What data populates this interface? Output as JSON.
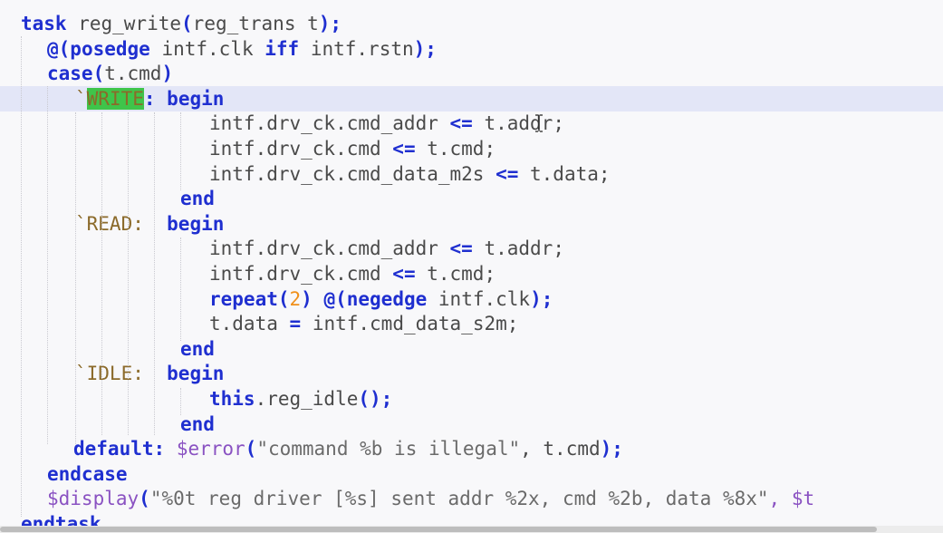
{
  "editor": {
    "lines": [
      [
        {
          "t": "task",
          "c": "kw"
        },
        {
          "t": " reg_write",
          "c": "plain"
        },
        {
          "t": "(",
          "c": "op"
        },
        {
          "t": "reg_trans t",
          "c": "plain"
        },
        {
          "t": ");",
          "c": "op"
        }
      ],
      [
        {
          "t": "@(",
          "c": "op"
        },
        {
          "t": "posedge",
          "c": "kw"
        },
        {
          "t": " intf.clk ",
          "c": "plain"
        },
        {
          "t": "iff",
          "c": "kw"
        },
        {
          "t": " intf.rstn",
          "c": "plain"
        },
        {
          "t": ");",
          "c": "op"
        }
      ],
      [
        {
          "t": "case",
          "c": "kw"
        },
        {
          "t": "(",
          "c": "op"
        },
        {
          "t": "t.cmd",
          "c": "plain"
        },
        {
          "t": ")",
          "c": "op"
        }
      ],
      [
        {
          "t": "`",
          "c": "mac"
        },
        {
          "t": "WRITE",
          "c": "mac-hl"
        },
        {
          "t": ": ",
          "c": "op"
        },
        {
          "t": "begin",
          "c": "kw"
        }
      ],
      [
        {
          "t": "intf.drv_ck.cmd_addr ",
          "c": "plain"
        },
        {
          "t": "<=",
          "c": "op"
        },
        {
          "t": " t.addr;",
          "c": "plain"
        }
      ],
      [
        {
          "t": "intf.drv_ck.cmd ",
          "c": "plain"
        },
        {
          "t": "<=",
          "c": "op"
        },
        {
          "t": " t.cmd;",
          "c": "plain"
        }
      ],
      [
        {
          "t": "intf.drv_ck.cmd_data_m2s ",
          "c": "plain"
        },
        {
          "t": "<=",
          "c": "op"
        },
        {
          "t": " t.data;",
          "c": "plain"
        }
      ],
      [
        {
          "t": "end",
          "c": "kw"
        }
      ],
      [
        {
          "t": "`READ:  ",
          "c": "mac"
        },
        {
          "t": "begin",
          "c": "kw"
        }
      ],
      [
        {
          "t": "intf.drv_ck.cmd_addr ",
          "c": "plain"
        },
        {
          "t": "<=",
          "c": "op"
        },
        {
          "t": " t.addr;",
          "c": "plain"
        }
      ],
      [
        {
          "t": "intf.drv_ck.cmd ",
          "c": "plain"
        },
        {
          "t": "<=",
          "c": "op"
        },
        {
          "t": " t.cmd;",
          "c": "plain"
        }
      ],
      [
        {
          "t": "repeat",
          "c": "kw"
        },
        {
          "t": "(",
          "c": "op"
        },
        {
          "t": "2",
          "c": "num"
        },
        {
          "t": ") @(",
          "c": "op"
        },
        {
          "t": "negedge",
          "c": "kw"
        },
        {
          "t": " intf.clk",
          "c": "plain"
        },
        {
          "t": ");",
          "c": "op"
        }
      ],
      [
        {
          "t": "t.data ",
          "c": "plain"
        },
        {
          "t": "=",
          "c": "op"
        },
        {
          "t": " intf.cmd_data_s2m;",
          "c": "plain"
        }
      ],
      [
        {
          "t": "end",
          "c": "kw"
        }
      ],
      [
        {
          "t": "`IDLE:  ",
          "c": "mac"
        },
        {
          "t": "begin",
          "c": "kw"
        }
      ],
      [
        {
          "t": "this",
          "c": "kw"
        },
        {
          "t": ".reg_idle",
          "c": "plain"
        },
        {
          "t": "();",
          "c": "op"
        }
      ],
      [
        {
          "t": "end",
          "c": "kw"
        }
      ],
      [
        {
          "t": "default",
          "c": "kw"
        },
        {
          "t": ": ",
          "c": "op"
        },
        {
          "t": "$error",
          "c": "sys"
        },
        {
          "t": "(",
          "c": "op"
        },
        {
          "t": "\"command %b is illegal\"",
          "c": "str"
        },
        {
          "t": ", t.cmd",
          "c": "plain"
        },
        {
          "t": ");",
          "c": "op"
        }
      ],
      [
        {
          "t": "endcase",
          "c": "kw"
        }
      ],
      [
        {
          "t": "$display",
          "c": "sys"
        },
        {
          "t": "(",
          "c": "op"
        },
        {
          "t": "\"%0t reg driver [%s] sent addr %2x, cmd %2b, data %8x\"",
          "c": "str"
        },
        {
          "t": ", $t",
          "c": "sys"
        }
      ],
      [
        {
          "t": "endtask",
          "c": "kw"
        }
      ]
    ]
  },
  "icons": {
    "text_cursor": "i-beam-cursor-icon"
  },
  "colors": {
    "background": "#f8f8fa",
    "current_line": "#e3e6f7",
    "keyword": "#1f2fd0",
    "macro": "#8b6a2a",
    "match_highlight": "#3fc44a",
    "number": "#f0901a",
    "system_task": "#8a52c2",
    "string": "#6a6a6a",
    "identifier": "#4a4a4a"
  }
}
